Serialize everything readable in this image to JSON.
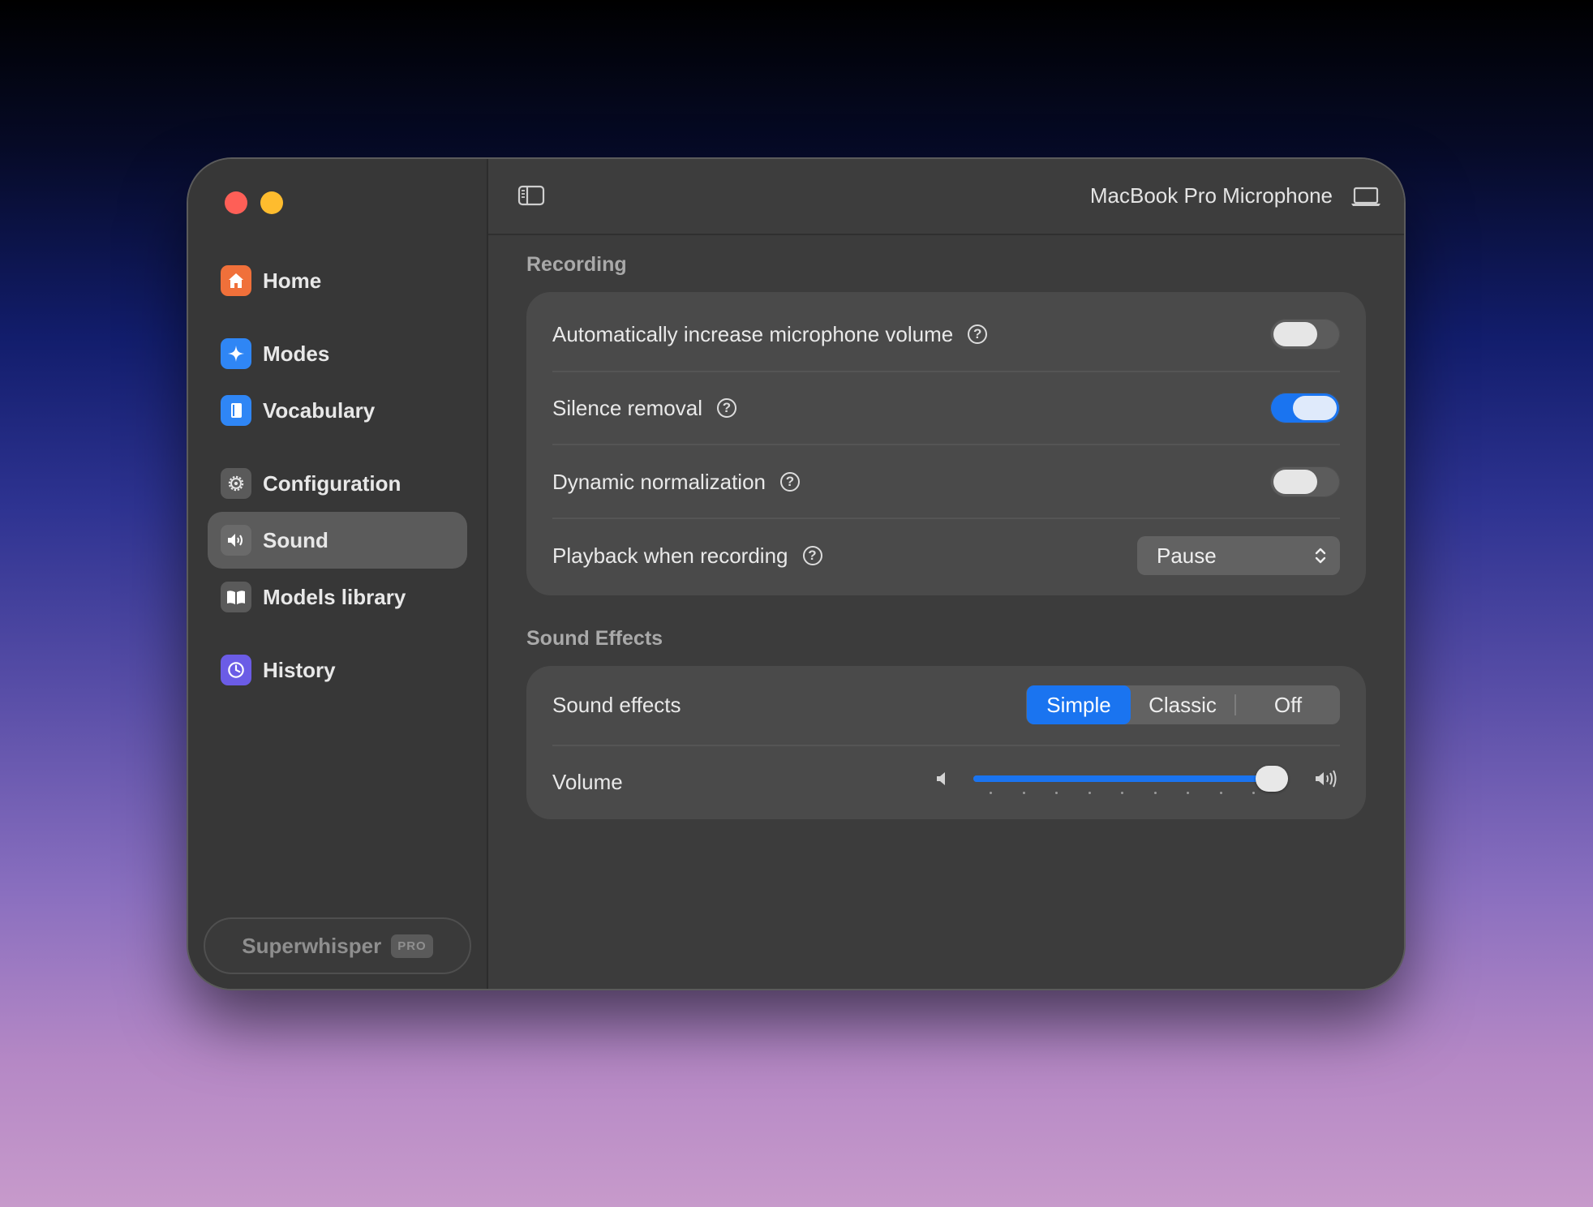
{
  "sidebar": {
    "items": [
      {
        "label": "Home",
        "icon": "house-icon",
        "color": "#f0703a"
      },
      {
        "label": "Modes",
        "icon": "sparkle-icon",
        "color": "#2f86f5"
      },
      {
        "label": "Vocabulary",
        "icon": "book-icon",
        "color": "#2f86f5"
      },
      {
        "label": "Configuration",
        "icon": "gear-icon",
        "color": "#5a5a5a"
      },
      {
        "label": "Sound",
        "icon": "speaker-icon",
        "color": "#5a5a5a",
        "active": true
      },
      {
        "label": "Models library",
        "icon": "open-book-icon",
        "color": "#5a5a5a"
      },
      {
        "label": "History",
        "icon": "history-icon",
        "color": "#6b5ce6"
      }
    ],
    "brand": {
      "name": "Superwhisper",
      "badge": "PRO"
    }
  },
  "header": {
    "microphone": "MacBook Pro Microphone"
  },
  "recording": {
    "title": "Recording",
    "auto_volume": {
      "label": "Automatically increase microphone volume",
      "on": false
    },
    "silence_removal": {
      "label": "Silence removal",
      "on": true
    },
    "dynamic_normalization": {
      "label": "Dynamic normalization",
      "on": false
    },
    "playback": {
      "label": "Playback when recording",
      "value": "Pause"
    }
  },
  "sound_effects": {
    "title": "Sound Effects",
    "effects": {
      "label": "Sound effects",
      "options": [
        "Simple",
        "Classic",
        "Off"
      ],
      "selected": "Simple"
    },
    "volume": {
      "label": "Volume",
      "value": 1.0
    }
  },
  "help_glyph": "?",
  "colors": {
    "accent": "#1a74f0",
    "close": "#fe5f57",
    "minimize": "#febc2e"
  }
}
